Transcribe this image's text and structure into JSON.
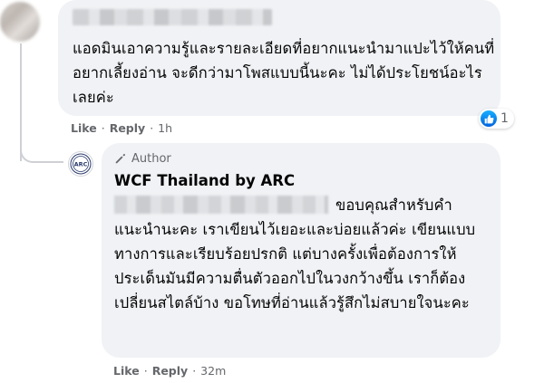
{
  "comment": {
    "text": "แอดมินเอาความรู้และรายละเอียดที่อยากแนะนำมาแปะไว้ให้คนที่อยากเลี้ยงอ่าน จะดีกว่ามาโพสแบบนี้นะคะ ไม่ได้ประโยชน์อะไรเลยค่ะ",
    "reaction_count": "1",
    "like_label": "Like",
    "reply_label": "Reply",
    "time": "1h"
  },
  "reply": {
    "author_badge": "Author",
    "page_name": "WCF Thailand by ARC",
    "avatar_text": "ARC",
    "text": "ขอบคุณสำหรับคำแนะนำนะคะ เราเขียนไว้เยอะและบ่อยแล้วค่ะ เขียนแบบทางการและเรียบร้อยปรกติ แต่บางครั้งเพื่อต้องการให้ประเด็นมันมีความตื่นตัวออกไปในวงกว้างขึ้น เราก็ต้องเปลี่ยนสไตล์บ้าง ขอโทษที่อ่านแล้วรู้สึกไม่สบายใจนะคะ",
    "like_label": "Like",
    "reply_label": "Reply",
    "time": "32m"
  },
  "colors": {
    "bubble": "#f0f2f5",
    "meta": "#65676b",
    "text": "#050505",
    "like_blue": "#1877f2"
  },
  "icons": {
    "reaction": "thumbs-up-icon",
    "author": "pencil-author-icon"
  }
}
